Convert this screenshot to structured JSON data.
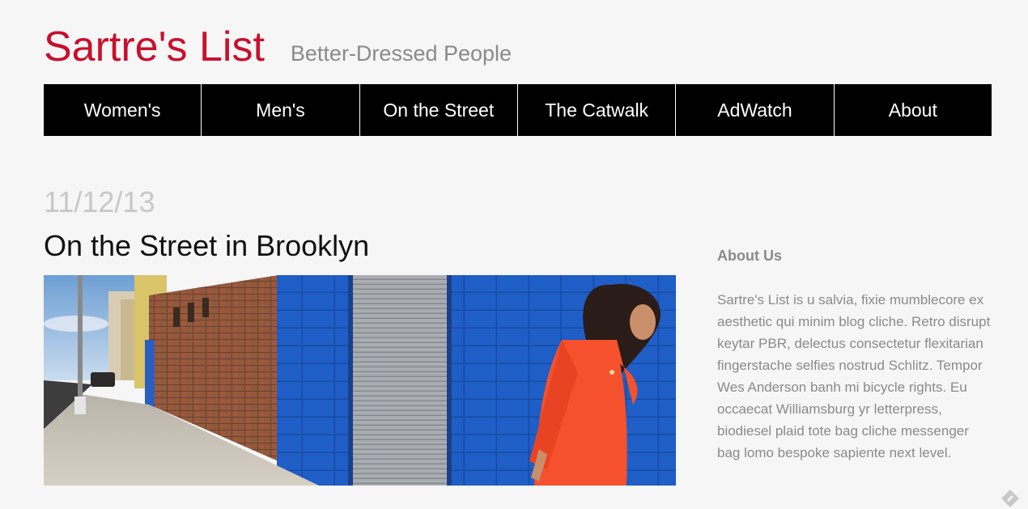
{
  "header": {
    "site_title": "Sartre's List",
    "tagline": "Better-Dressed People"
  },
  "nav": {
    "items": [
      {
        "label": "Women's"
      },
      {
        "label": "Men's"
      },
      {
        "label": "On the Street"
      },
      {
        "label": "The Catwalk"
      },
      {
        "label": "AdWatch"
      },
      {
        "label": "About"
      }
    ]
  },
  "post": {
    "date": "11/12/13",
    "title": "On the Street in Brooklyn"
  },
  "sidebar": {
    "heading": "About Us",
    "body": "Sartre's List is u salvia, fixie mumblecore ex aesthetic qui minim blog cliche. Retro disrupt keytar PBR, delectus consectetur flexitarian fingerstache selfies nostrud Schlitz. Tempor Wes Anderson banh mi bicycle rights. Eu occaecat Williamsburg yr letterpress, biodiesel plaid tote bag cliche messenger bag lomo bespoke sapiente next level."
  },
  "colors": {
    "brand": "#c8102e",
    "nav_bg": "#000000",
    "muted_text": "#8a8a8a",
    "date_text": "#c8c8c8"
  }
}
